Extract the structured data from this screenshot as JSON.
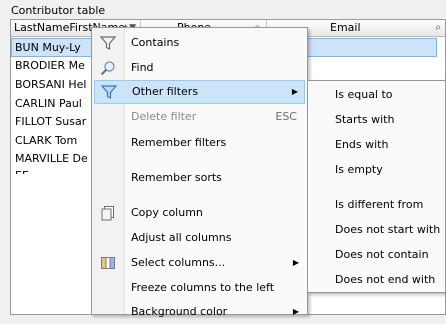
{
  "caption": "Contributor table",
  "table": {
    "columns": [
      "LastNameFirstName",
      "Phone",
      "Email"
    ],
    "rows": [
      "BUN Muy-Ly",
      "BRODIER Me",
      "BORSANI Hel",
      "CARLIN Paul",
      "FILLOT Susar",
      "CLARK Tom",
      "MARVILLE De",
      "EE"
    ]
  },
  "context_menu": {
    "items": [
      {
        "label": "Contains",
        "icon": "funnel-icon"
      },
      {
        "label": "Find",
        "icon": "magnifier-icon"
      },
      {
        "label": "Other filters",
        "icon": "funnel-icon",
        "highlighted": true,
        "submenu": true
      },
      {
        "label": "Delete filter",
        "shortcut": "ESC",
        "disabled": true
      },
      {
        "label": "Remember filters"
      },
      {
        "label": "Remember sorts"
      },
      {
        "label": "Copy column",
        "icon": "copy-icon"
      },
      {
        "label": "Adjust all columns"
      },
      {
        "label": "Select columns...",
        "icon": "columns-icon",
        "submenu": true
      },
      {
        "label": "Freeze columns to the left"
      },
      {
        "label": "Background color",
        "submenu": true
      }
    ]
  },
  "submenu": {
    "items": [
      "Is equal to",
      "Starts with",
      "Ends with",
      "Is empty",
      "Is different from",
      "Does not start with",
      "Does not contain",
      "Does not end with"
    ]
  },
  "colors": {
    "highlight": "#cce4f7",
    "selected_row": "#cde3f7",
    "funnel_blue": "#3a78c2"
  }
}
